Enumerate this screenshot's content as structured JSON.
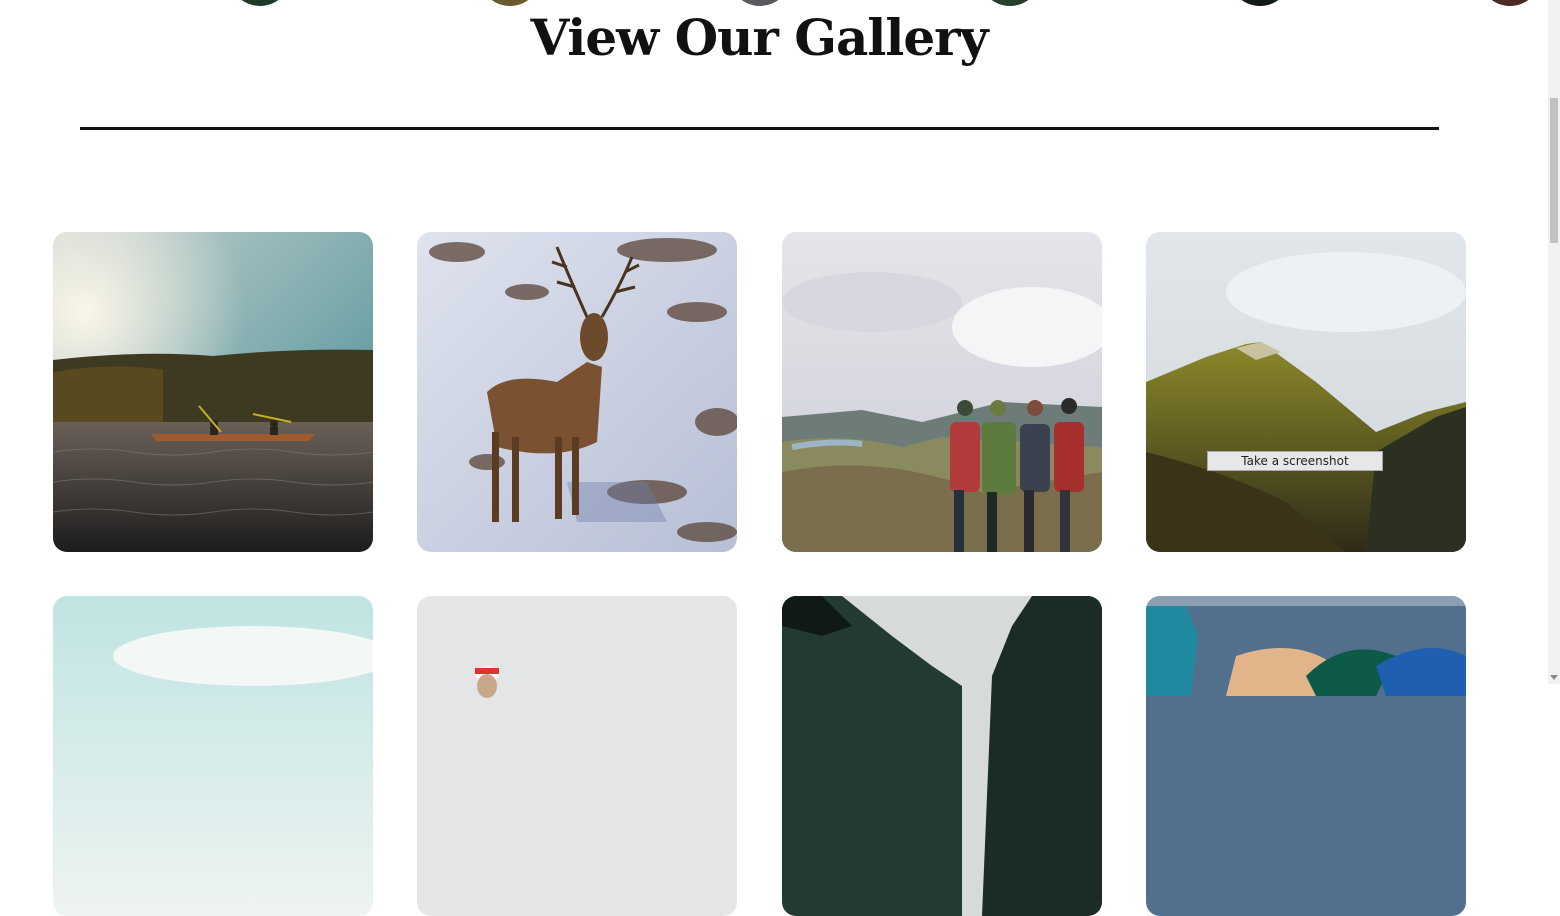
{
  "gallery": {
    "title": "View Our Gallery",
    "images": [
      {
        "subject": "kayakers-on-lake"
      },
      {
        "subject": "red-deer-stag-in-snow"
      },
      {
        "subject": "hikers-overlooking-valley"
      },
      {
        "subject": "green-mountain-peak"
      },
      {
        "subject": "pale-sky-landscape"
      },
      {
        "subject": "climber-with-cap"
      },
      {
        "subject": "fjord-cliffs"
      },
      {
        "subject": "kayak-closeup"
      }
    ]
  },
  "tooltip": {
    "text": "Take a screenshot"
  },
  "colors": {
    "heading": "#111111",
    "divider": "#111111",
    "background": "#ffffff"
  }
}
